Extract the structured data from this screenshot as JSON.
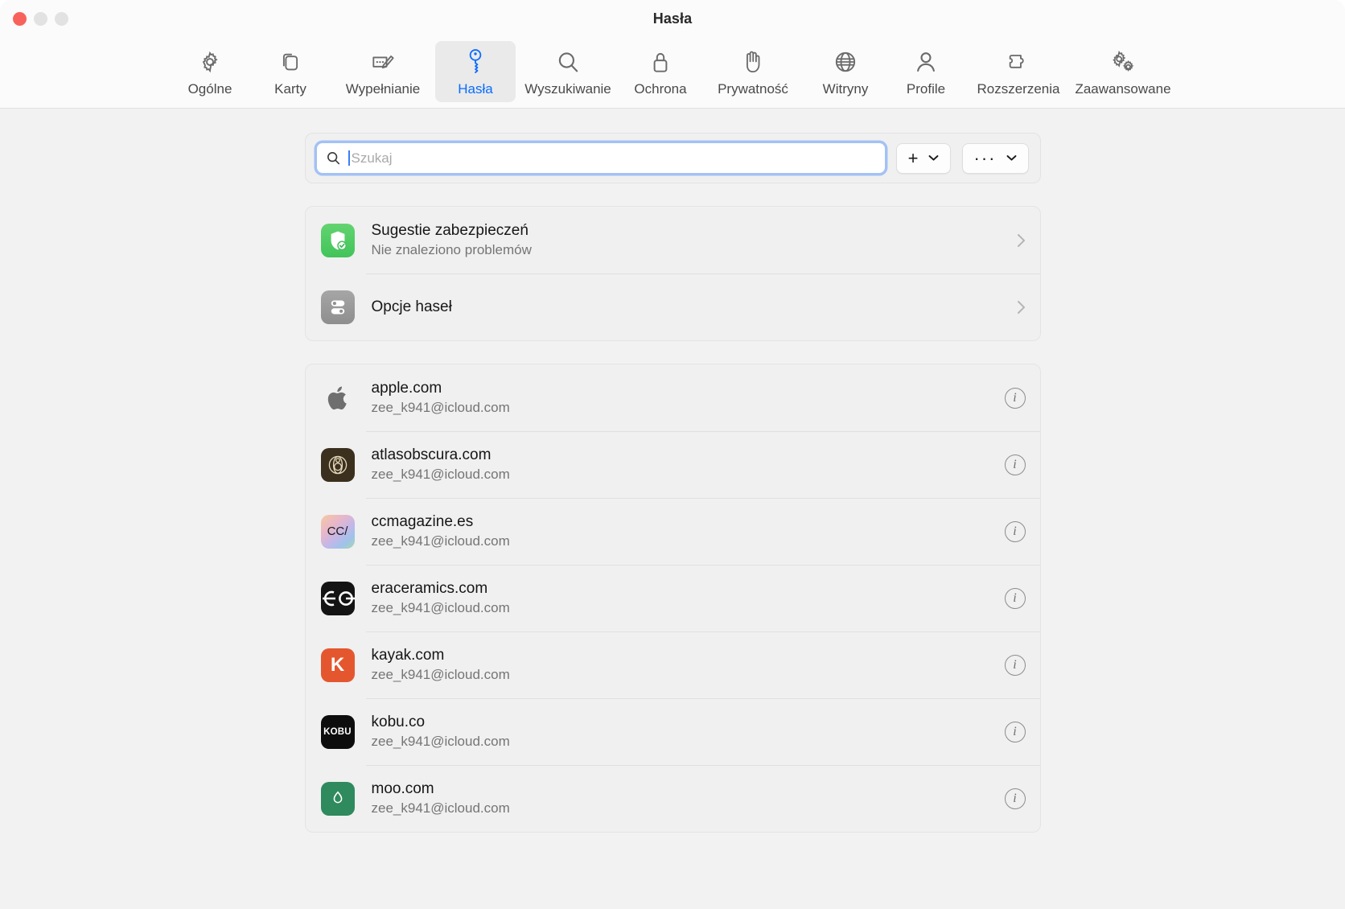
{
  "window": {
    "title": "Hasła",
    "traffic_lights": [
      "close",
      "minimize",
      "maximize"
    ]
  },
  "toolbar": {
    "items": [
      {
        "label": "Ogólne",
        "icon": "gear-icon",
        "selected": false
      },
      {
        "label": "Karty",
        "icon": "tabs-icon",
        "selected": false
      },
      {
        "label": "Wypełnianie",
        "icon": "autofill-icon",
        "selected": false
      },
      {
        "label": "Hasła",
        "icon": "key-icon",
        "selected": true
      },
      {
        "label": "Wyszukiwanie",
        "icon": "magnifier-icon",
        "selected": false
      },
      {
        "label": "Ochrona",
        "icon": "lock-icon",
        "selected": false
      },
      {
        "label": "Prywatność",
        "icon": "hand-icon",
        "selected": false
      },
      {
        "label": "Witryny",
        "icon": "globe-icon",
        "selected": false
      },
      {
        "label": "Profile",
        "icon": "person-icon",
        "selected": false
      },
      {
        "label": "Rozszerzenia",
        "icon": "puzzle-icon",
        "selected": false
      },
      {
        "label": "Zaawansowane",
        "icon": "gears-icon",
        "selected": false
      }
    ]
  },
  "search": {
    "placeholder": "Szukaj",
    "value": "",
    "icon": "search-icon"
  },
  "actions": {
    "add": {
      "glyph": "+",
      "chevron": "⌄",
      "name": "add-password-button"
    },
    "more": {
      "glyph": "···",
      "chevron": "⌄",
      "name": "more-options-button"
    }
  },
  "settings_rows": [
    {
      "title": "Sugestie zabezpieczeń",
      "subtitle": "Nie znaleziono problemów",
      "icon": "shield-check-icon",
      "icon_style": "fav-green",
      "accessory": "chevron-right-icon"
    },
    {
      "title": "Opcje haseł",
      "subtitle": "",
      "icon": "password-options-icon",
      "icon_style": "fav-gray",
      "accessory": "chevron-right-icon"
    }
  ],
  "passwords": [
    {
      "site": "apple.com",
      "account": "zee_k941@icloud.com",
      "icon": "apple-favicon",
      "icon_style": "fav-apple",
      "icon_text": ""
    },
    {
      "site": "atlasobscura.com",
      "account": "zee_k941@icloud.com",
      "icon": "atlasobscura-favicon",
      "icon_style": "fav-atlas",
      "icon_text": ""
    },
    {
      "site": "ccmagazine.es",
      "account": "zee_k941@icloud.com",
      "icon": "ccmagazine-favicon",
      "icon_style": "fav-cc",
      "icon_text": "CC/"
    },
    {
      "site": "eraceramics.com",
      "account": "zee_k941@icloud.com",
      "icon": "eraceramics-favicon",
      "icon_style": "fav-era",
      "icon_text": ""
    },
    {
      "site": "kayak.com",
      "account": "zee_k941@icloud.com",
      "icon": "kayak-favicon",
      "icon_style": "fav-kayak",
      "icon_text": "K"
    },
    {
      "site": "kobu.co",
      "account": "zee_k941@icloud.com",
      "icon": "kobu-favicon",
      "icon_style": "fav-kobu",
      "icon_text": "KOBU"
    },
    {
      "site": "moo.com",
      "account": "zee_k941@icloud.com",
      "icon": "moo-favicon",
      "icon_style": "fav-moo",
      "icon_text": ""
    }
  ],
  "row_accessory": {
    "info": "info-icon"
  },
  "colors": {
    "accent": "#0a6cff",
    "focus_ring": "#a3c2f5",
    "window_bg": "#f2f2f2",
    "toolbar_bg": "#fbfbfb",
    "card_bg": "#f0f0f0"
  }
}
